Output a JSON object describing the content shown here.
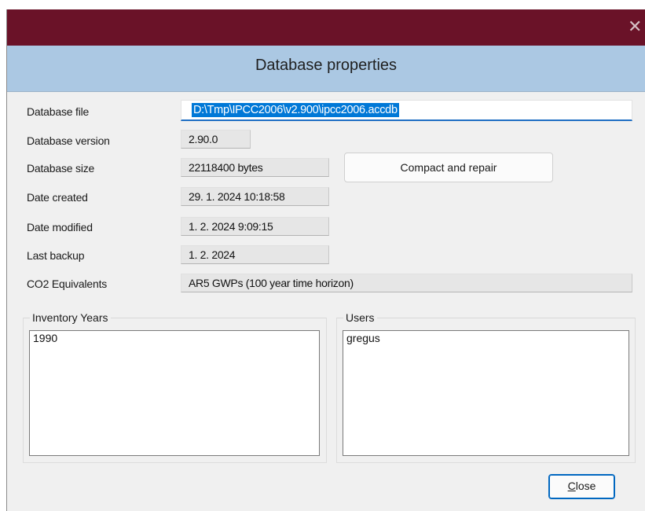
{
  "window": {
    "close_glyph": "✕"
  },
  "header": {
    "title": "Database properties"
  },
  "fields": {
    "database_file": {
      "label": "Database file",
      "value": "D:\\Tmp\\IPCC2006\\v2.900\\ipcc2006.accdb"
    },
    "database_version": {
      "label": "Database version",
      "value": "2.90.0"
    },
    "database_size": {
      "label": "Database size",
      "value": "22118400 bytes"
    },
    "date_created": {
      "label": "Date created",
      "value": "29. 1. 2024 10:18:58"
    },
    "date_modified": {
      "label": "Date modified",
      "value": "1. 2. 2024 9:09:15"
    },
    "last_backup": {
      "label": "Last backup",
      "value": "1. 2. 2024"
    },
    "co2_equivalents": {
      "label": "CO2 Equivalents",
      "value": "AR5 GWPs (100 year time horizon)"
    }
  },
  "buttons": {
    "compact_repair": "Compact and repair",
    "close_mnemonic": "C",
    "close_rest": "lose"
  },
  "groups": {
    "inventory_years": {
      "title": "Inventory Years",
      "items": [
        "1990"
      ]
    },
    "users": {
      "title": "Users",
      "items": [
        "gregus"
      ]
    }
  },
  "colors": {
    "titlebar": "#6a1228",
    "header_band": "#abc8e3",
    "selection": "#0078d7",
    "focus_border": "#0067c0"
  }
}
